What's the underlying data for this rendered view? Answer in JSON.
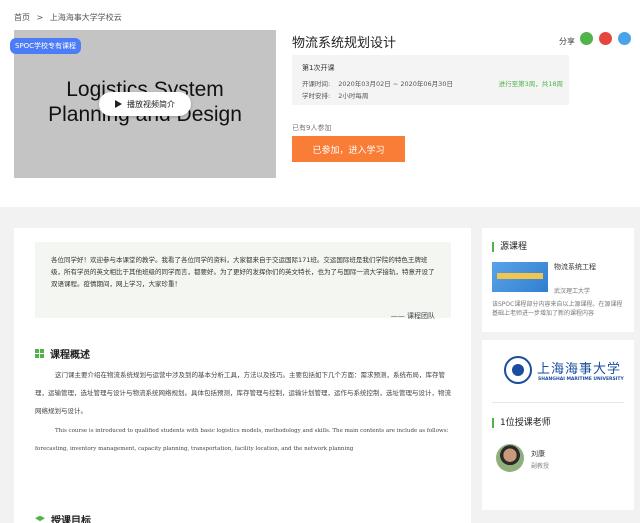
{
  "breadcrumb": {
    "home": "首页",
    "sep": ">",
    "current": "上海海事大学学校云"
  },
  "video": {
    "badge": "SPOC学校专有课程",
    "title_line1": "Logistics  System",
    "title_line2": "Planning and Design",
    "play_label": "播放视频简介"
  },
  "course": {
    "title": "物流系统规划设计",
    "share_label": "分享",
    "term": "第1次开课",
    "time_label": "开课时间:",
    "time_value": "2020年03月02日 ~ 2020年06月30日",
    "schedule_label": "学时安排:",
    "schedule_value": "2小时每周",
    "progress": "进行至第3周，共18周",
    "joined": "已有9人参加",
    "enter_button": "已参加，进入学习"
  },
  "share_colors": {
    "wechat": "#52b34a",
    "weibo": "#e5463c",
    "qq": "#4aa3e8"
  },
  "intro": {
    "text": "各位同学好！欢迎参与本课堂的教学。我看了各位同学的资料，大家都来自于交运国际171班。交运国际班是我们学院的特色王牌班级，所有学员的英文相比于其他班级的同学而言，都要好。为了更好的发挥你们的英文特长，也为了与国际一流大学接轨，特意开设了双语课程。疫情期间，网上学习，大家珍重！",
    "signature": "—— 课程团队"
  },
  "overview": {
    "title": "课程概述",
    "cn_text": "这门课主要介绍在物流系统规划与运营中涉及到的基本分析工具，方法以及技巧。主要包括如下几个方面：需求预测，系统布局，库存管理，运输管理，选址管理与设计与物流系统网络规划。具体包括预测，库存管理与控制，运输计划管理，运作与系统控制，选址管理与设计，物流网络规划与设计。",
    "en_text": "This course is introduced to  qualified  students with basic logistics models, methodology and skills.  The main contents are include as follows: forecasting,  inventory  management, capacity planning, transportation, facility location, and the network planning"
  },
  "goal": {
    "title": "授课目标"
  },
  "source": {
    "title": "源课程",
    "course_name": "物流系统工程",
    "school": "武汉理工大学",
    "note": "该SPOC课程部分内容来自以上源课程。在源课程基础上老师进一步增加了新的课程内容"
  },
  "university": {
    "name_cn": "上海海事大学",
    "name_en": "SHANGHAI MARITIME UNIVERSITY"
  },
  "teachers": {
    "title": "1位授课老师",
    "list": [
      {
        "name": "刘康",
        "role": "副教授"
      }
    ]
  }
}
